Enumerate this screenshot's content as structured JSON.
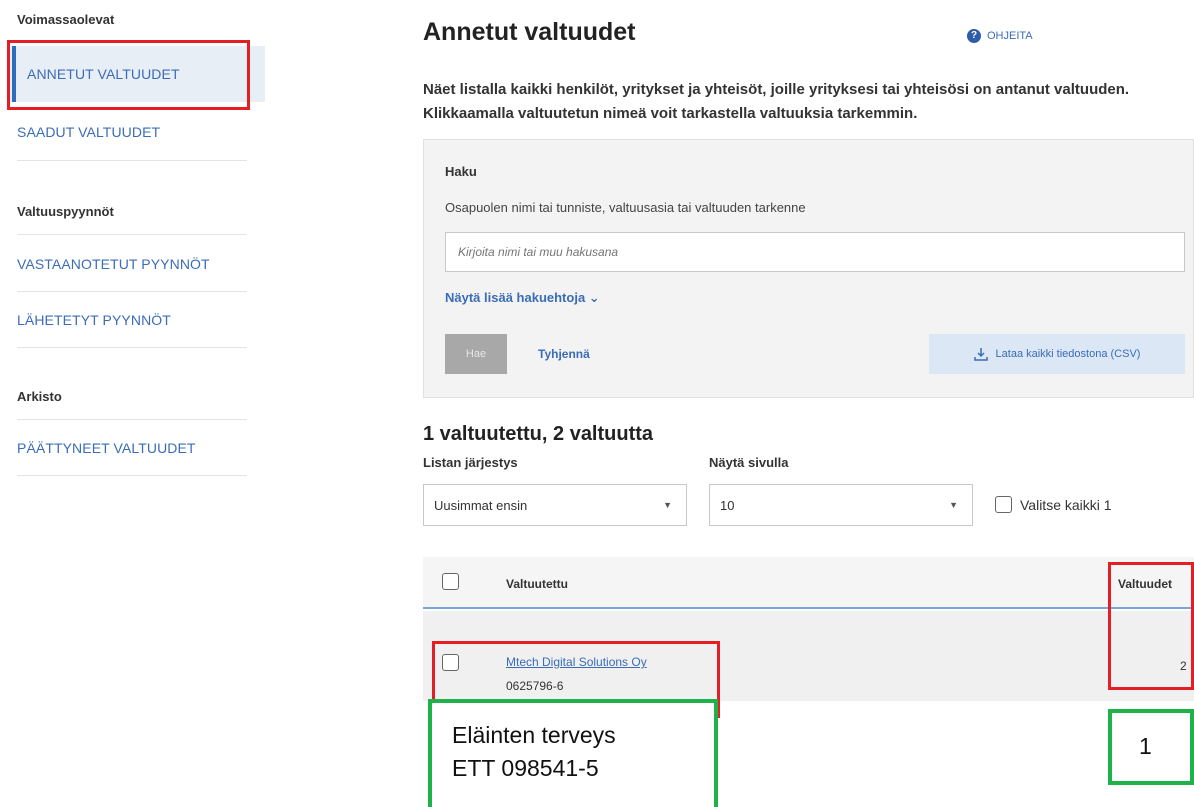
{
  "sidebar": {
    "section_active": "Voimassaolevat",
    "item_given": "ANNETUT VALTUUDET",
    "item_received": "SAADUT VALTUUDET",
    "section_requests": "Valtuuspyynnöt",
    "item_incoming": "VASTAANOTETUT PYYNNÖT",
    "item_sent": "LÄHETETYT PYYNNÖT",
    "section_archive": "Arkisto",
    "item_ended": "PÄÄTTYNEET VALTUUDET"
  },
  "header": {
    "title": "Annetut valtuudet",
    "help_label": "OHJEITA",
    "intro": "Näet listalla kaikki henkilöt, yritykset ja yhteisöt, joille yrityksesi tai yhteisösi on antanut valtuuden. Klikkaamalla valtuutetun nimeä voit tarkastella valtuuksia tarkemmin."
  },
  "search": {
    "label": "Haku",
    "description": "Osapuolen nimi tai tunniste, valtuusasia tai valtuuden tarkenne",
    "placeholder": "Kirjoita nimi tai muu hakusana",
    "more_filters": "Näytä lisää hakuehtoja ⌄",
    "search_button": "Hae",
    "clear_button": "Tyhjennä",
    "csv_button": "Lataa kaikki tiedostona (CSV)"
  },
  "results": {
    "count_text": "1 valtuutettu, 2 valtuutta",
    "sort_label": "Listan järjestys",
    "sort_value": "Uusimmat ensin",
    "page_label": "Näytä sivulla",
    "page_value": "10",
    "select_all": "Valitse kaikki 1"
  },
  "table": {
    "col_name": "Valtuutettu",
    "col_count": "Valtuudet",
    "rows": [
      {
        "name": "Mtech Digital Solutions Oy",
        "id": "0625796-6",
        "count": "2"
      }
    ]
  },
  "annotations": {
    "note_left_line1": "Eläinten terveys",
    "note_left_line2": "ETT 098541-5",
    "note_right": "1"
  },
  "colors": {
    "link": "#3b6cb7",
    "highlight_red": "#e31e24",
    "highlight_green": "#1fb24a"
  }
}
